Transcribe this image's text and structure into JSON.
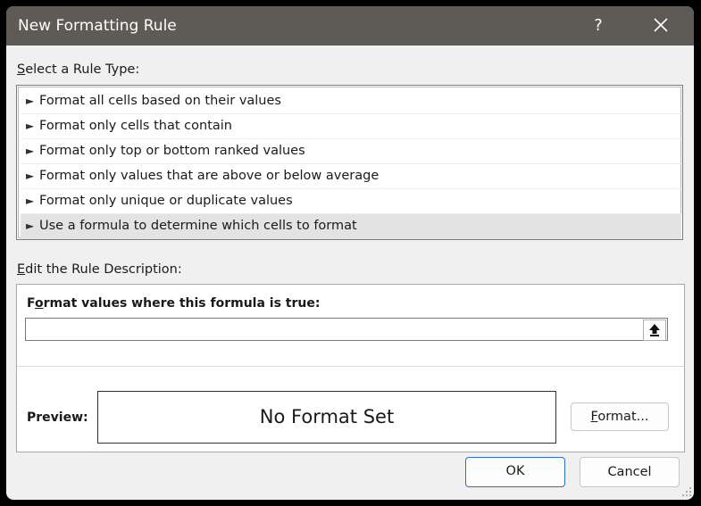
{
  "dialog": {
    "title": "New Formatting Rule",
    "help_label": "?",
    "close_icon": "close-icon"
  },
  "rule_type": {
    "label_accel": "S",
    "label_rest": "elect a Rule Type:",
    "item_icon": "►",
    "items": [
      {
        "label": "Format all cells based on their values"
      },
      {
        "label": "Format only cells that contain"
      },
      {
        "label": "Format only top or bottom ranked values"
      },
      {
        "label": "Format only values that are above or below average"
      },
      {
        "label": "Format only unique or duplicate values"
      },
      {
        "label": "Use a formula to determine which cells to format"
      }
    ],
    "selected_index": 5
  },
  "description": {
    "label_accel": "E",
    "label_rest": "dit the Rule Description:",
    "formula_label_pre": "F",
    "formula_label_accel": "o",
    "formula_label_rest": "rmat values where this formula is true:",
    "formula_value": "",
    "collapse_icon": "collapse-dialog-icon",
    "preview_label": "Preview:",
    "preview_text": "No Format Set",
    "format_button_accel": "F",
    "format_button_rest": "ormat..."
  },
  "footer": {
    "ok_label": "OK",
    "cancel_label": "Cancel"
  },
  "colors": {
    "titlebar": "#5e5a55",
    "dialog_bg": "#f0f0f0",
    "selected_row": "#e3e3e3",
    "ok_border": "#2a6fc9"
  }
}
